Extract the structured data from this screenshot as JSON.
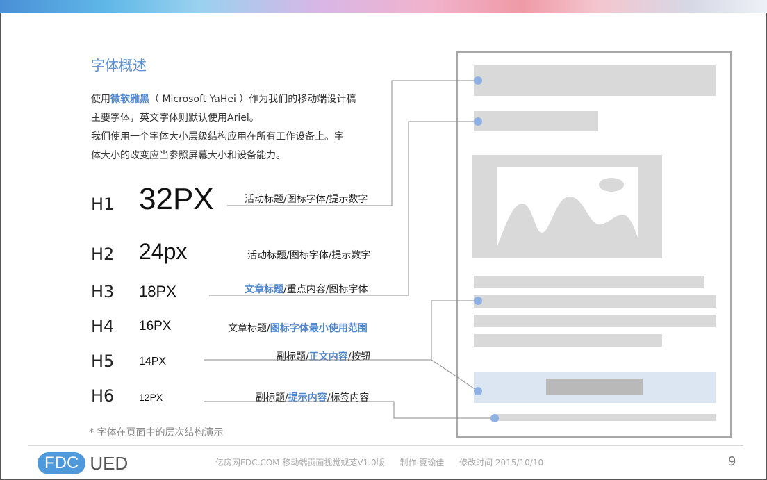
{
  "section_title": "字体概述",
  "intro": {
    "line1_pre": "使用",
    "line1_hl": "微软雅黑",
    "line1_post": "（ Microsoft YaHei ）作为我们的移动端设计稿",
    "line2": "主要字体，英文字体则默认使用Ariel。",
    "line3": "我们使用一个字体大小层级结构应用在所有工作设备上。字",
    "line4": "体大小的改变应当参照屏幕大小和设备能力。"
  },
  "levels": [
    {
      "tag": "H1",
      "size": "32PX",
      "desc_pre": "活动标题/图标字体/提示数字",
      "desc_hl": "",
      "desc_post": ""
    },
    {
      "tag": "H2",
      "size": "24px",
      "desc_pre": "活动标题/图标字体/提示数字",
      "desc_hl": "",
      "desc_post": ""
    },
    {
      "tag": "H3",
      "size": "18PX",
      "desc_pre": "",
      "desc_hl": "文章标题",
      "desc_post": "/重点内容/图标字体"
    },
    {
      "tag": "H4",
      "size": "16PX",
      "desc_pre": "文章标题/",
      "desc_hl": "图标字体最小使用范围",
      "desc_post": ""
    },
    {
      "tag": "H5",
      "size": "14PX",
      "desc_pre": "副标题/",
      "desc_hl": "正文内容",
      "desc_post": "/按钮"
    },
    {
      "tag": "H6",
      "size": "12PX",
      "desc_pre": "副标题/",
      "desc_hl": "提示内容",
      "desc_post": "/标签内容"
    }
  ],
  "note": "* 字体在页面中的层次结构演示",
  "footer": {
    "logo_left": "FDC",
    "logo_right": "UED",
    "site": "亿房网FDC.COM 移动端页面视觉规范V1.0版",
    "author": "制作 夏瑜佳",
    "modified": "修改时间  2015/10/10",
    "page": "9"
  },
  "colors": {
    "accent": "#4d86cf",
    "mock_gray": "#d9d9d9",
    "mock_button_bg": "#dce6f3",
    "dot": "#8fb0e3",
    "logo_blue": "#4e99dc"
  },
  "icons": [
    "image-placeholder-icon"
  ]
}
